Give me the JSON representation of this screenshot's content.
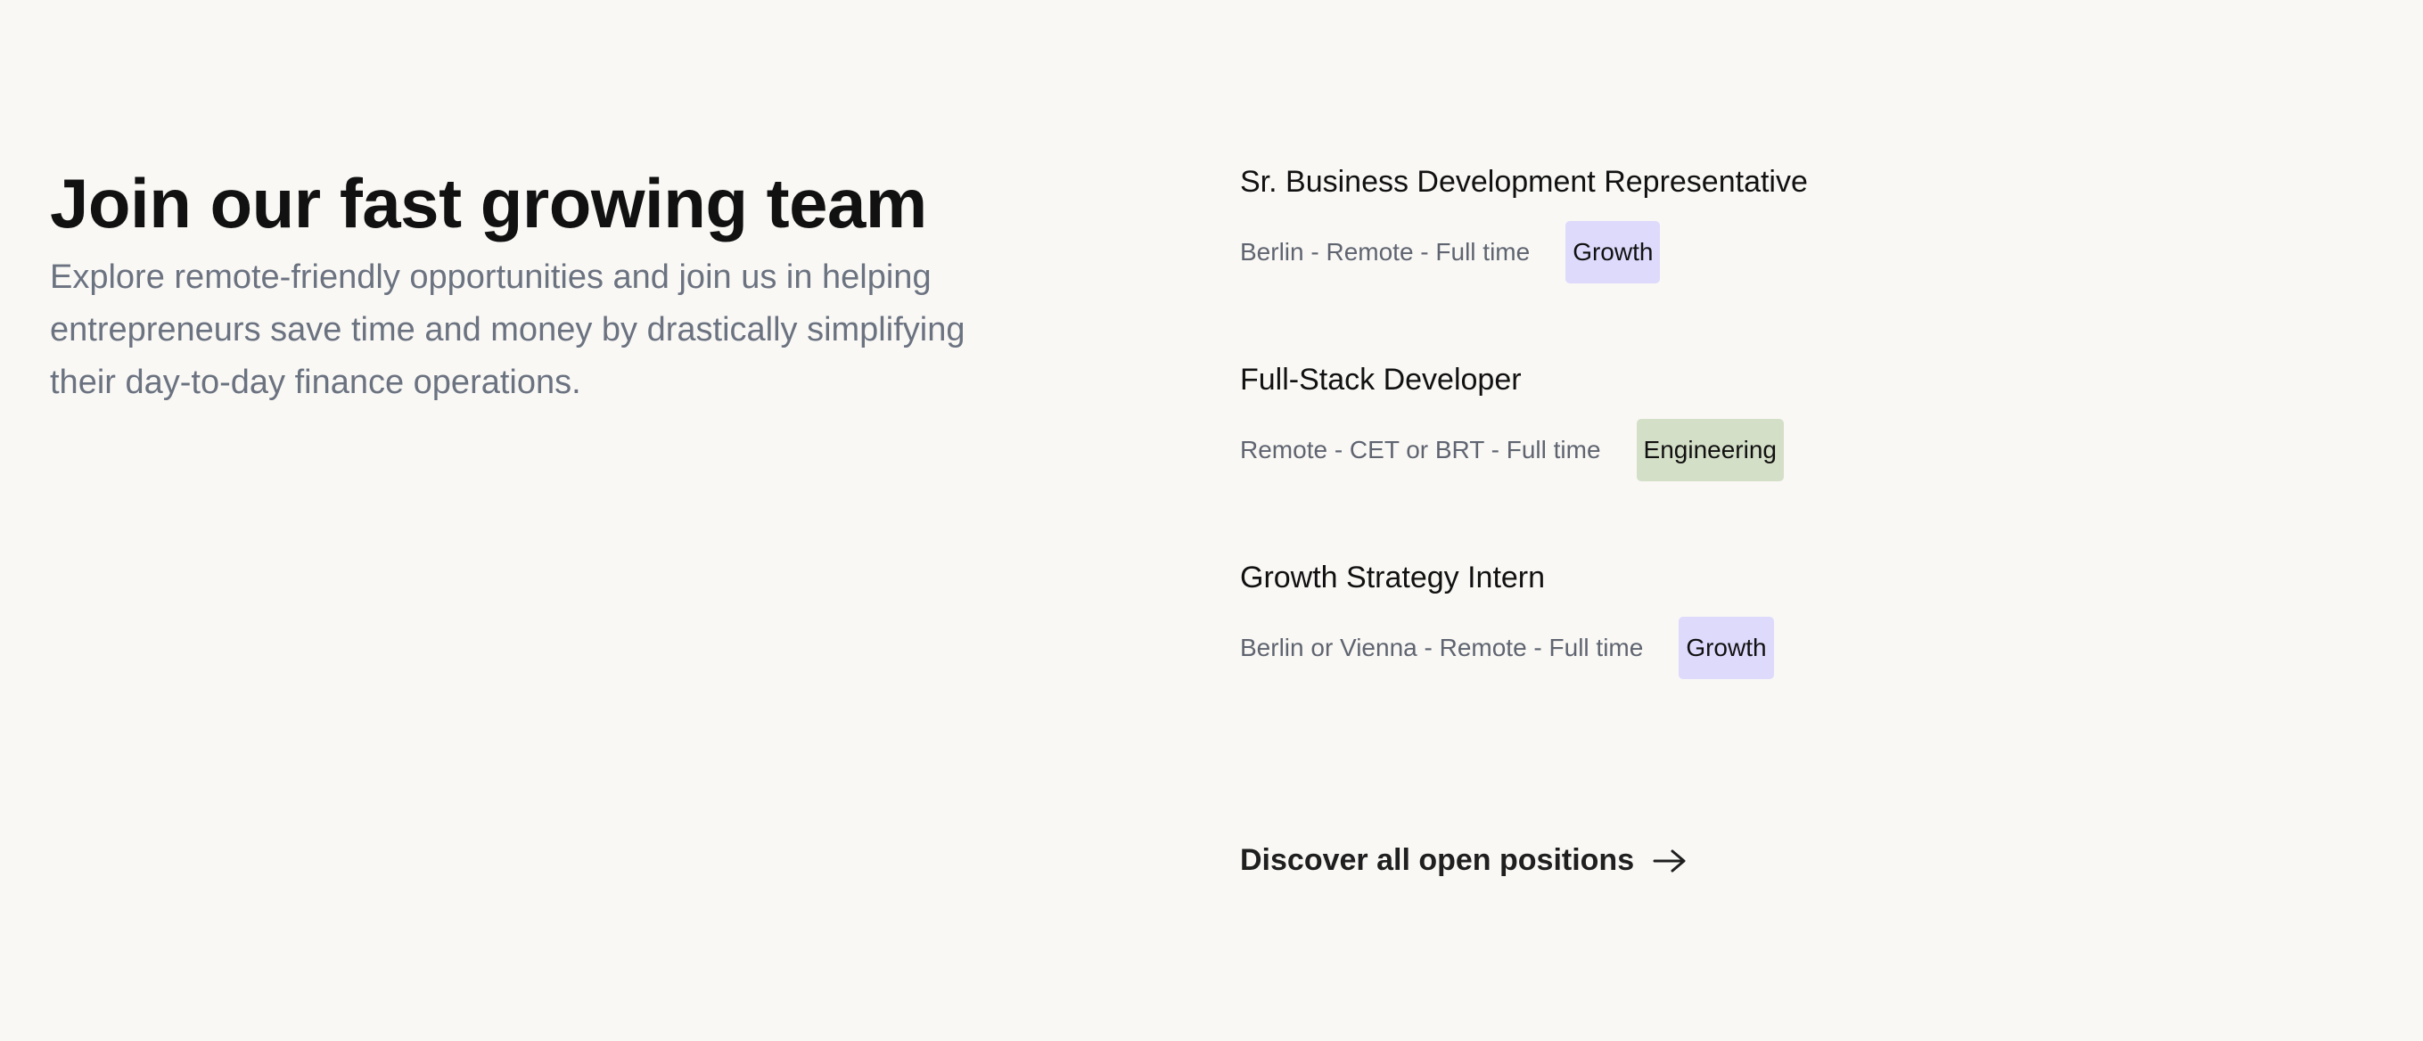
{
  "hero": {
    "title": "Join our fast growing team",
    "description": "Explore remote-friendly opportunities and join us in helping entrepreneurs save time and money by drastically simplifying their day-to-day finance operations."
  },
  "jobs": [
    {
      "title": "Sr. Business Development Representative",
      "location": "Berlin - Remote - Full time",
      "tag": "Growth"
    },
    {
      "title": "Full-Stack Developer",
      "location": "Remote - CET or BRT - Full time",
      "tag": "Engineering"
    },
    {
      "title": "Growth Strategy Intern",
      "location": "Berlin or Vienna - Remote - Full time",
      "tag": "Growth"
    }
  ],
  "cta": {
    "label": "Discover all open positions",
    "icon": "arrow-right-icon"
  },
  "colors": {
    "background": "#f9f8f5",
    "tag_growth": "#dddafc",
    "tag_engineering": "#d4dfc7",
    "muted_text": "#6b7280"
  }
}
